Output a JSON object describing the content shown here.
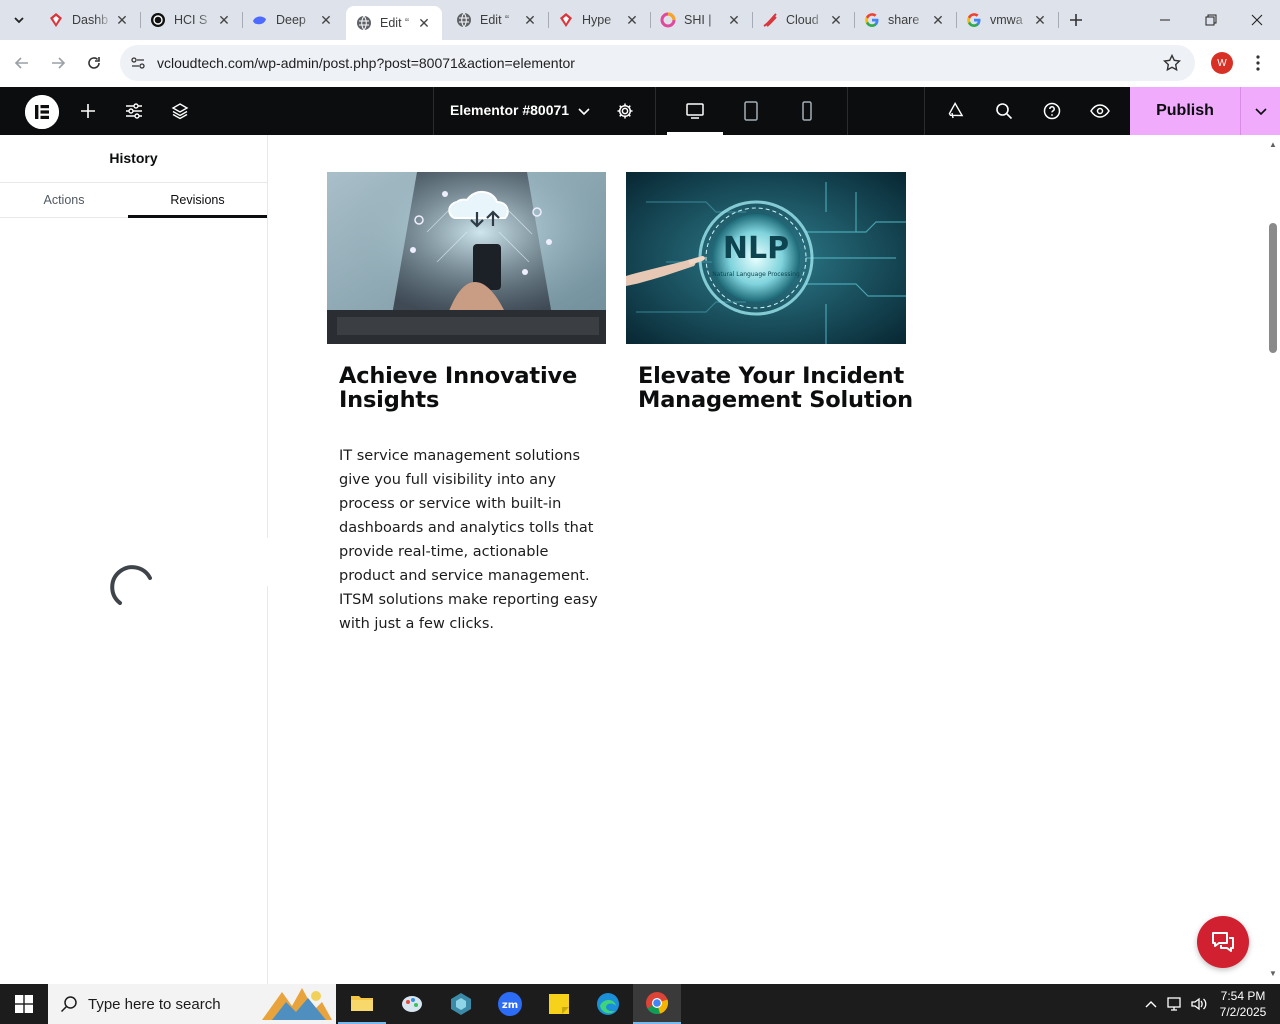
{
  "browser": {
    "tabs": [
      {
        "title": "Dashb",
        "icon": "gem-icon"
      },
      {
        "title": "HCI S",
        "icon": "openai-icon"
      },
      {
        "title": "Deep",
        "icon": "whale-icon"
      },
      {
        "title": "Edit “",
        "icon": "globe-icon",
        "active": true
      },
      {
        "title": "Edit “",
        "icon": "globe-icon"
      },
      {
        "title": "Hype",
        "icon": "gem-icon"
      },
      {
        "title": "SHI | ",
        "icon": "ring-icon"
      },
      {
        "title": "Cloud",
        "icon": "swoosh-icon"
      },
      {
        "title": "share",
        "icon": "google-icon"
      },
      {
        "title": "vmwa",
        "icon": "google-icon"
      }
    ],
    "url": "vcloudtech.com/wp-admin/post.php?post=80071&action=elementor",
    "profile_initial": "W"
  },
  "editor": {
    "document_title": "Elementor #80071",
    "publish_label": "Publish"
  },
  "panel": {
    "title": "History",
    "tabs": [
      "Actions",
      "Revisions"
    ],
    "active_tab": "Revisions"
  },
  "canvas": {
    "cards": [
      {
        "heading_line1": "Achieve Innovative",
        "heading_line2": "Insights",
        "body": "IT service management solutions give you full visibility into any process or service with built-in dashboards and analytics tolls that provide real-time, actionable product and service management. ITSM solutions make reporting easy with just a few clicks."
      },
      {
        "heading_line1": "Elevate Your Incident",
        "heading_line2": "Management Solution",
        "image_text": "NLP",
        "image_subtext": "Natural Language Processing"
      }
    ]
  },
  "taskbar": {
    "search_placeholder": "Type here to search",
    "time": "7:54 PM",
    "date": "7/2/2025"
  },
  "colors": {
    "publish_bg": "#f0abfc",
    "editor_bar": "#0c0d0e",
    "chat_button": "#d1202f"
  }
}
